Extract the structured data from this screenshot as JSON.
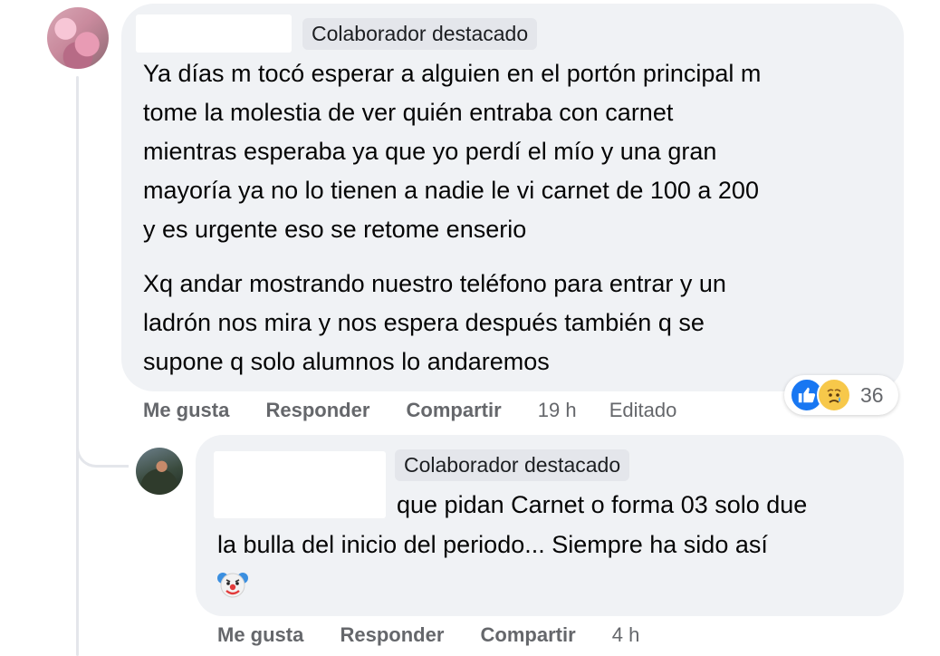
{
  "comments": [
    {
      "badge": "Colaborador destacado",
      "paragraph1": [
        "Ya días m tocó esperar a alguien en el portón principal m",
        "tome la molestia de ver quién entraba con carnet",
        "mientras esperaba ya que yo perdí el mío y una gran",
        "mayoría ya no lo tienen a nadie le vi carnet de 100 a 200",
        "y es urgente eso se retome enserio"
      ],
      "paragraph2": [
        "Xq andar mostrando nuestro teléfono para entrar y un",
        "ladrón nos mira y nos espera después también q se",
        "supone q solo alumnos lo andaremos"
      ],
      "actions": {
        "like": "Me gusta",
        "reply": "Responder",
        "share": "Compartir"
      },
      "time": "19 h",
      "edited": "Editado",
      "reactions": {
        "icons": [
          "like-icon",
          "sad-icon"
        ],
        "count": "36"
      }
    },
    {
      "badge": "Colaborador destacado",
      "lines": [
        "que pidan Carnet o forma 03 solo due",
        "la bulla del inicio del periodo... Siempre ha sido así"
      ],
      "emoji": "clown-face-icon",
      "actions": {
        "like": "Me gusta",
        "reply": "Responder",
        "share": "Compartir"
      },
      "time": "4 h"
    }
  ],
  "colors": {
    "bubble": "#f0f2f5",
    "badge_bg": "#e4e6eb",
    "meta_text": "#65676b",
    "like_blue": "#1877f2",
    "sad_yellow": "#f7c84a"
  }
}
